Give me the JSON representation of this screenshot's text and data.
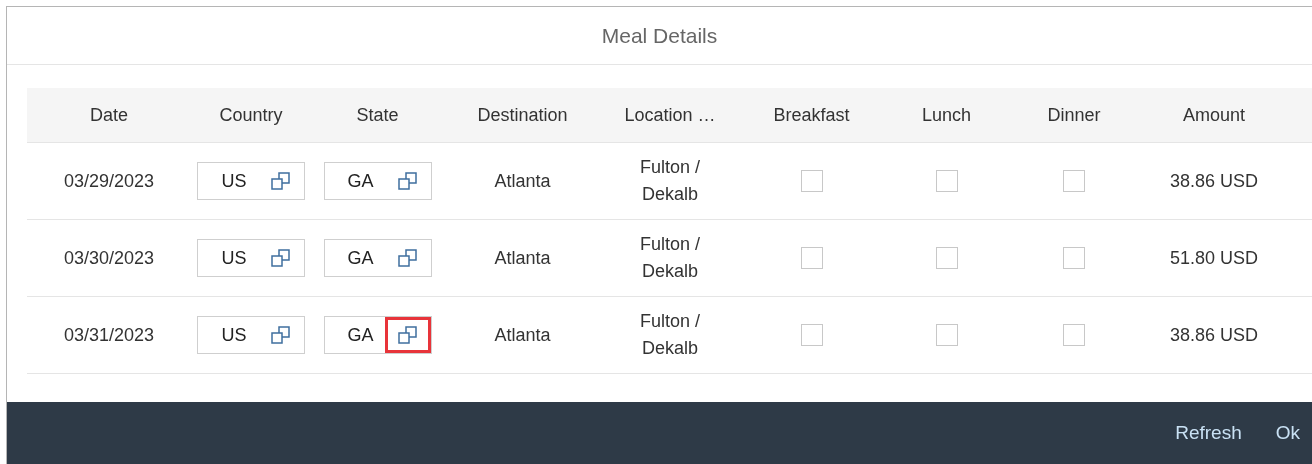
{
  "dialog": {
    "title": "Meal Details"
  },
  "table": {
    "columns": [
      "Date",
      "Country",
      "State",
      "Destination",
      "Location …",
      "Breakfast",
      "Lunch",
      "Dinner",
      "Amount"
    ],
    "rows": [
      {
        "date": "03/29/2023",
        "country": {
          "value": "US",
          "highlighted": false
        },
        "state": {
          "value": "GA",
          "highlighted": false
        },
        "destination": "Atlanta",
        "location": "Fulton / Dekalb",
        "breakfast": false,
        "lunch": false,
        "dinner": false,
        "amount": "38.86 USD"
      },
      {
        "date": "03/30/2023",
        "country": {
          "value": "US",
          "highlighted": false
        },
        "state": {
          "value": "GA",
          "highlighted": false
        },
        "destination": "Atlanta",
        "location": "Fulton / Dekalb",
        "breakfast": false,
        "lunch": false,
        "dinner": false,
        "amount": "51.80 USD"
      },
      {
        "date": "03/31/2023",
        "country": {
          "value": "US",
          "highlighted": false
        },
        "state": {
          "value": "GA",
          "highlighted": true
        },
        "destination": "Atlanta",
        "location": "Fulton / Dekalb",
        "breakfast": false,
        "lunch": false,
        "dinner": false,
        "amount": "38.86 USD"
      }
    ]
  },
  "footer": {
    "buttons": [
      "Refresh",
      "Ok"
    ]
  }
}
